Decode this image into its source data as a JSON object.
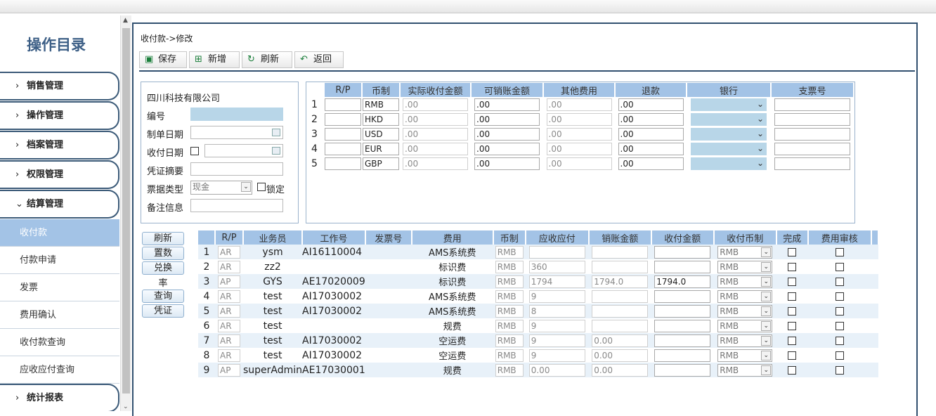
{
  "sidebar": {
    "title": "操作目录",
    "sections": [
      {
        "label": "销售管理",
        "expanded": false
      },
      {
        "label": "操作管理",
        "expanded": false
      },
      {
        "label": "档案管理",
        "expanded": false
      },
      {
        "label": "权限管理",
        "expanded": false
      },
      {
        "label": "结算管理",
        "expanded": true
      }
    ],
    "sub_items": [
      "收付款",
      "付款申请",
      "发票",
      "费用确认",
      "收付款查询",
      "应收应付查询"
    ],
    "active_sub": "收付款",
    "last_section": "统计报表"
  },
  "breadcrumb": "收付款->修改",
  "toolbar": {
    "save_label": "保存",
    "new_label": "新增",
    "refresh_label": "刷新",
    "back_label": "返回"
  },
  "form": {
    "company": "四川科技有限公司",
    "number_label": "编号",
    "number_value": "",
    "create_date_label": "制单日期",
    "pay_date_label": "收付日期",
    "voucher_summary_label": "凭证摘要",
    "bill_type_label": "票据类型",
    "bill_type_value": "现金",
    "lock_label": "锁定",
    "remark_label": "备注信息"
  },
  "currency_table": {
    "headers": [
      "R/P",
      "币制",
      "实际收付金额",
      "可销账金额",
      "其他费用",
      "退款",
      "银行",
      "支票号"
    ],
    "rows": [
      {
        "no": "1",
        "currency": "RMB",
        "actual": ".00",
        "writeoff": ".00",
        "other": ".00",
        "refund": ".00"
      },
      {
        "no": "2",
        "currency": "HKD",
        "actual": ".00",
        "writeoff": ".00",
        "other": ".00",
        "refund": ".00"
      },
      {
        "no": "3",
        "currency": "USD",
        "actual": ".00",
        "writeoff": ".00",
        "other": ".00",
        "refund": ".00"
      },
      {
        "no": "4",
        "currency": "EUR",
        "actual": ".00",
        "writeoff": ".00",
        "other": ".00",
        "refund": ".00"
      },
      {
        "no": "5",
        "currency": "GBP",
        "actual": ".00",
        "writeoff": ".00",
        "other": ".00",
        "refund": ".00"
      }
    ]
  },
  "side_buttons": [
    "刷新",
    "置数",
    "兑换",
    "率",
    "查询",
    "凭证"
  ],
  "detail_table": {
    "headers": [
      "R/P",
      "业务员",
      "工作号",
      "发票号",
      "费用",
      "币制",
      "应收应付",
      "销账金额",
      "收付金额",
      "收付币制",
      "完成",
      "费用审核"
    ],
    "rows": [
      {
        "no": "1",
        "rp": "AR",
        "staff": "ysm",
        "job": "AI16110004",
        "invoice": "",
        "fee": "AMS系统费",
        "currency": "RMB",
        "due": "",
        "writeoff": "",
        "paid": "",
        "pay_currency": "RMB"
      },
      {
        "no": "2",
        "rp": "AR",
        "staff": "zz2",
        "job": "",
        "invoice": "",
        "fee": "标识费",
        "currency": "RMB",
        "due": "360",
        "writeoff": "",
        "paid": "",
        "pay_currency": "RMB"
      },
      {
        "no": "3",
        "rp": "AP",
        "staff": "GYS",
        "job": "AE17020009",
        "invoice": "",
        "fee": "标识费",
        "currency": "RMB",
        "due": "1794",
        "writeoff": "1794.0",
        "paid": "1794.0",
        "pay_currency": "RMB"
      },
      {
        "no": "4",
        "rp": "AR",
        "staff": "test",
        "job": "AI17030002",
        "invoice": "",
        "fee": "AMS系统费",
        "currency": "RMB",
        "due": "9",
        "writeoff": "",
        "paid": "",
        "pay_currency": "RMB"
      },
      {
        "no": "5",
        "rp": "AR",
        "staff": "test",
        "job": "AI17030002",
        "invoice": "",
        "fee": "AMS系统费",
        "currency": "RMB",
        "due": "8",
        "writeoff": "",
        "paid": "",
        "pay_currency": "RMB"
      },
      {
        "no": "6",
        "rp": "AR",
        "staff": "test",
        "job": "",
        "invoice": "",
        "fee": "规费",
        "currency": "RMB",
        "due": "9",
        "writeoff": "",
        "paid": "",
        "pay_currency": "RMB"
      },
      {
        "no": "7",
        "rp": "AR",
        "staff": "test",
        "job": "AI17030002",
        "invoice": "",
        "fee": "空运费",
        "currency": "RMB",
        "due": "9",
        "writeoff": "0.00",
        "paid": "",
        "pay_currency": "RMB"
      },
      {
        "no": "8",
        "rp": "AR",
        "staff": "test",
        "job": "AI17030002",
        "invoice": "",
        "fee": "空运费",
        "currency": "RMB",
        "due": "9",
        "writeoff": "0.00",
        "paid": "",
        "pay_currency": "RMB"
      },
      {
        "no": "9",
        "rp": "AP",
        "staff": "superAdmin",
        "job": "AE17030001",
        "invoice": "",
        "fee": "规费",
        "currency": "RMB",
        "due": "0.00",
        "writeoff": "0.00",
        "paid": "",
        "pay_currency": "RMB"
      }
    ]
  },
  "colors": {
    "accent": "#a3c3e6",
    "frame": "#31506f",
    "title": "#3d5f86"
  }
}
